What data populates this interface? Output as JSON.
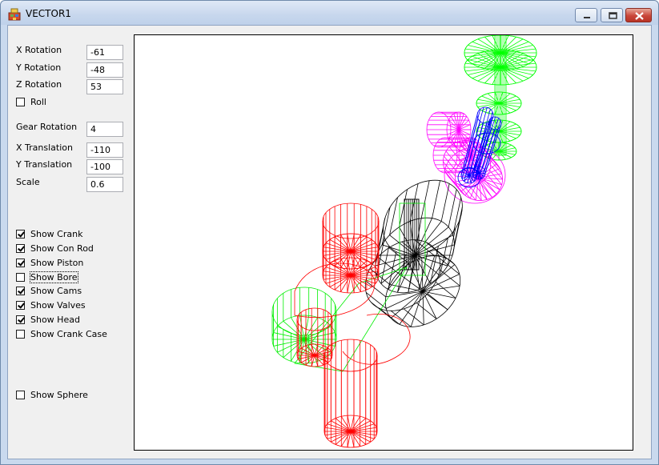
{
  "window": {
    "title": "VECTOR1",
    "icons": {
      "app": "app-icon",
      "minimize": "minimize-icon",
      "maximize": "maximize-icon",
      "close": "close-icon"
    }
  },
  "fields": {
    "x_rotation": {
      "label": "X Rotation",
      "value": "-61"
    },
    "y_rotation": {
      "label": "Y Rotation",
      "value": "-48"
    },
    "z_rotation": {
      "label": "Z Rotation",
      "value": "53"
    },
    "gear_rotation": {
      "label": "Gear Rotation",
      "value": "4"
    },
    "x_translation": {
      "label": "X Translation",
      "value": "-110"
    },
    "y_translation": {
      "label": "Y Translation",
      "value": "-100"
    },
    "scale": {
      "label": "Scale",
      "value": "0.6"
    }
  },
  "checkboxes": {
    "roll": {
      "label": "Roll",
      "checked": false
    },
    "show_crank": {
      "label": "Show Crank",
      "checked": true
    },
    "show_con_rod": {
      "label": "Show Con Rod",
      "checked": true
    },
    "show_piston": {
      "label": "Show Piston",
      "checked": true
    },
    "show_bore": {
      "label": "Show Bore",
      "checked": false
    },
    "show_cams": {
      "label": "Show Cams",
      "checked": true
    },
    "show_valves": {
      "label": "Show Valves",
      "checked": true
    },
    "show_head": {
      "label": "Show Head",
      "checked": true
    },
    "show_crank_case": {
      "label": "Show Crank Case",
      "checked": false
    },
    "show_sphere": {
      "label": "Show Sphere",
      "checked": false
    }
  },
  "colors": {
    "crank": "#ff0000",
    "con_rod": "#00ee00",
    "piston": "#000000",
    "cams": "#ff00ff",
    "valves": "#0000ff",
    "head": "#00ff00"
  }
}
